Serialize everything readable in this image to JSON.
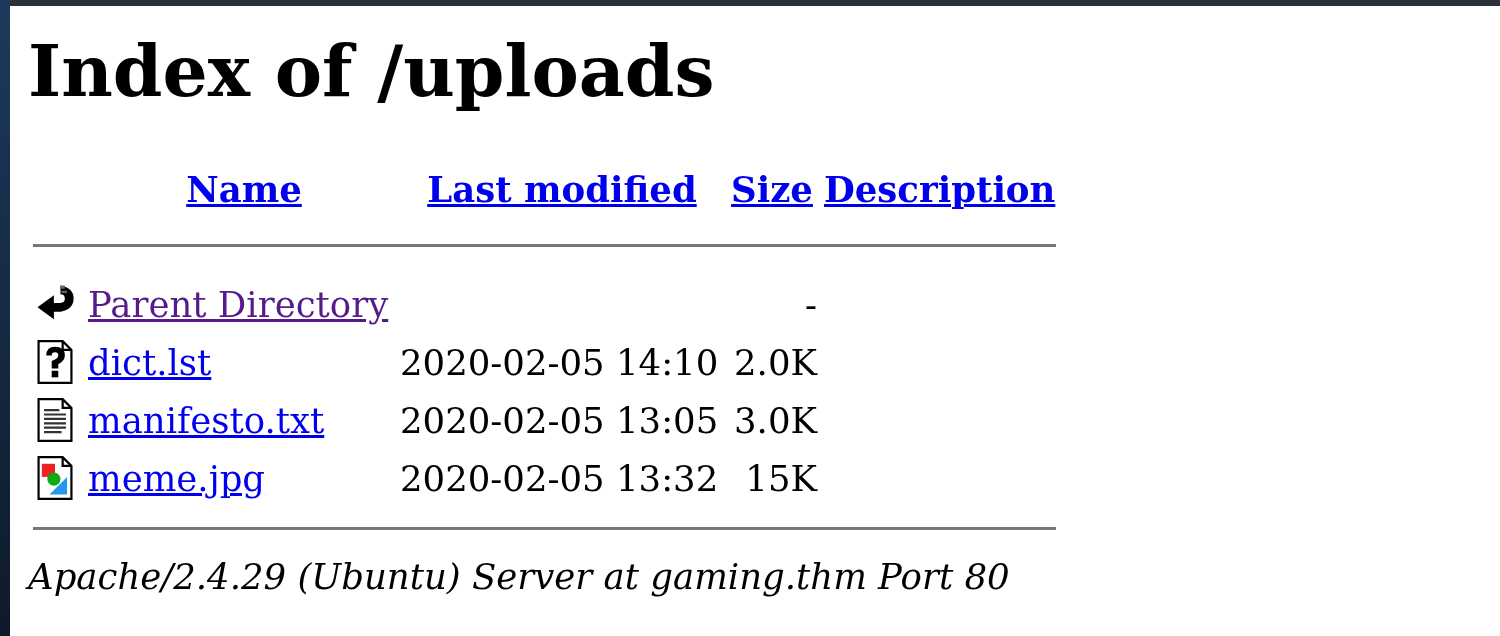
{
  "heading": "Index of /uploads",
  "columns": [
    {
      "kind": "name",
      "label": "Name"
    },
    {
      "kind": "modified",
      "label": "Last modified"
    },
    {
      "kind": "size",
      "label": "Size"
    },
    {
      "kind": "description",
      "label": "Description"
    }
  ],
  "rows": [
    {
      "kind": "back",
      "name": "Parent Directory",
      "visited": true,
      "size": "-"
    },
    {
      "kind": "unknown",
      "name": "dict.lst",
      "visited": false,
      "modified": "2020-02-05 14:10",
      "size": "2.0K"
    },
    {
      "kind": "text",
      "name": "manifesto.txt",
      "visited": false,
      "modified": "2020-02-05 13:05",
      "size": "3.0K"
    },
    {
      "kind": "image",
      "name": "meme.jpg",
      "visited": false,
      "modified": "2020-02-05 13:32",
      "size": "15K"
    }
  ],
  "footer": "Apache/2.4.29 (Ubuntu) Server at gaming.thm Port 80"
}
